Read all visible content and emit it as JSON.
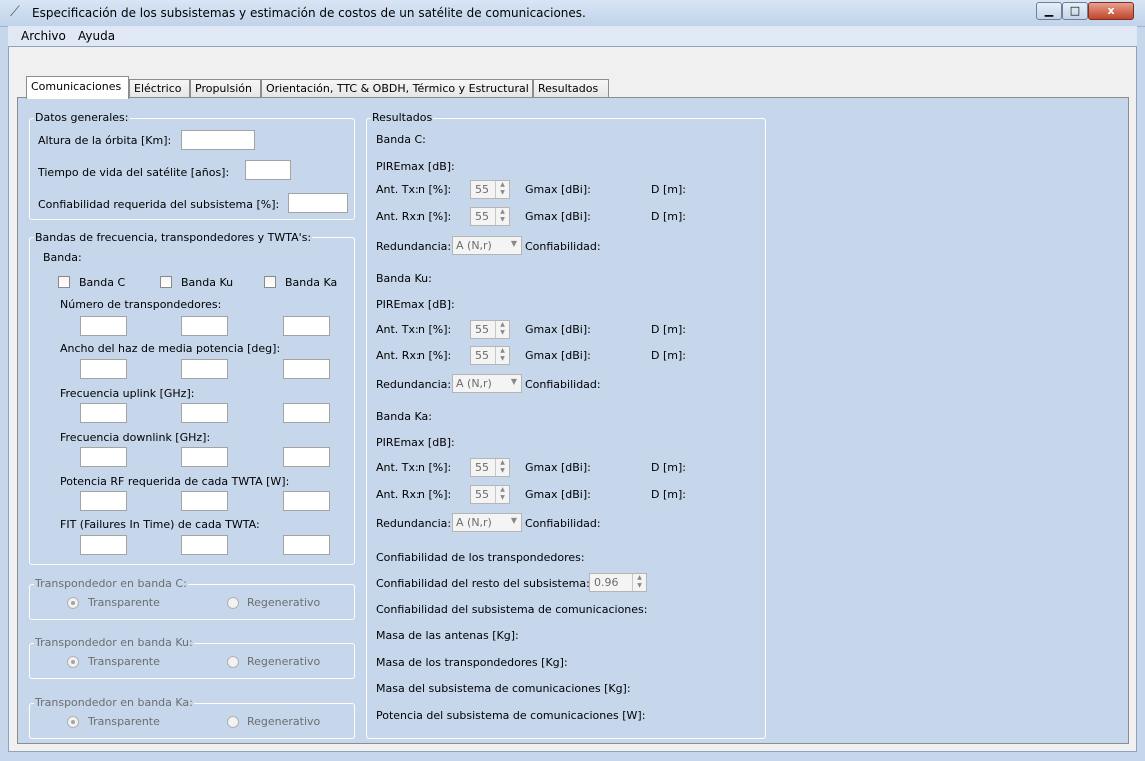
{
  "window": {
    "title": "Especificación de los subsistemas y estimación de costos de un satélite de comunicaciones.",
    "close_glyph": "x"
  },
  "menu": [
    "Archivo",
    "Ayuda"
  ],
  "tabs": [
    "Comunicaciones",
    "Eléctrico",
    "Propulsión",
    "Orientación, TTC & OBDH, Térmico y Estructural",
    "Resultados"
  ],
  "datos_generales": {
    "legend": "Datos generales:",
    "altura": "Altura de la órbita [Km]:",
    "vida": "Tiempo de vida del satélite [años]:",
    "confiabilidad": "Confiabilidad requerida del subsistema [%]:"
  },
  "bandas": {
    "legend": "Bandas de frecuencia, transpondedores y TWTA's:",
    "banda_label": "Banda:",
    "checkboxes": [
      "Banda C",
      "Banda Ku",
      "Banda Ka"
    ],
    "rows": [
      "Número de transpondedores:",
      "Ancho del haz de media potencia [deg]:",
      "Frecuencia uplink [GHz]:",
      "Frecuencia downlink [GHz]:",
      "Potencia RF  requerida de cada TWTA [W]:",
      "FIT (Failures In Time) de cada TWTA:"
    ]
  },
  "transponders": [
    {
      "legend": "Transpondedor en banda C:",
      "opt1": "Transparente",
      "opt2": "Regenerativo"
    },
    {
      "legend": "Transpondedor en banda Ku:",
      "opt1": "Transparente",
      "opt2": "Regenerativo"
    },
    {
      "legend": "Transpondedor en banda Ka:",
      "opt1": "Transparente",
      "opt2": "Regenerativo"
    }
  ],
  "resultados": {
    "legend": "Resultados",
    "bands": [
      {
        "title": "Banda C:",
        "pire": "PIREmax [dB]:",
        "tx": "Ant. Tx:",
        "rx": "Ant. Rx:",
        "n": "n [%]:",
        "n_value": "55",
        "gmax": "Gmax [dBi]:",
        "d": "D [m]:",
        "redundancia": "Redundancia:",
        "combo": "A (N,r)",
        "confiab": "Confiabilidad:"
      },
      {
        "title": "Banda Ku:",
        "pire": "PIREmax [dB]:",
        "tx": "Ant. Tx:",
        "rx": "Ant. Rx:",
        "n": "n [%]:",
        "n_value": "55",
        "gmax": "Gmax [dBi]:",
        "d": "D [m]:",
        "redundancia": "Redundancia:",
        "combo": "A (N,r)",
        "confiab": "Confiabilidad:"
      },
      {
        "title": "Banda Ka:",
        "pire": "PIREmax [dB]:",
        "tx": "Ant. Tx:",
        "rx": "Ant. Rx:",
        "n": "n [%]:",
        "n_value": "55",
        "gmax": "Gmax [dBi]:",
        "d": "D [m]:",
        "redundancia": "Redundancia:",
        "combo": "A (N,r)",
        "confiab": "Confiabilidad:"
      }
    ],
    "conf_trans": "Confiabilidad de los transpondedores:",
    "conf_resto": "Confiabilidad del resto del subsistema:",
    "conf_resto_value": "0.96",
    "conf_sub": "Confiabilidad del subsistema de comunicaciones:",
    "masa_ant": "Masa de las antenas [Kg]:",
    "masa_trans": "Masa de los transpondedores [Kg]:",
    "masa_sub": "Masa del subsistema de comunicaciones [Kg]:",
    "potencia": "Potencia del subsistema de comunicaciones [W]:"
  }
}
